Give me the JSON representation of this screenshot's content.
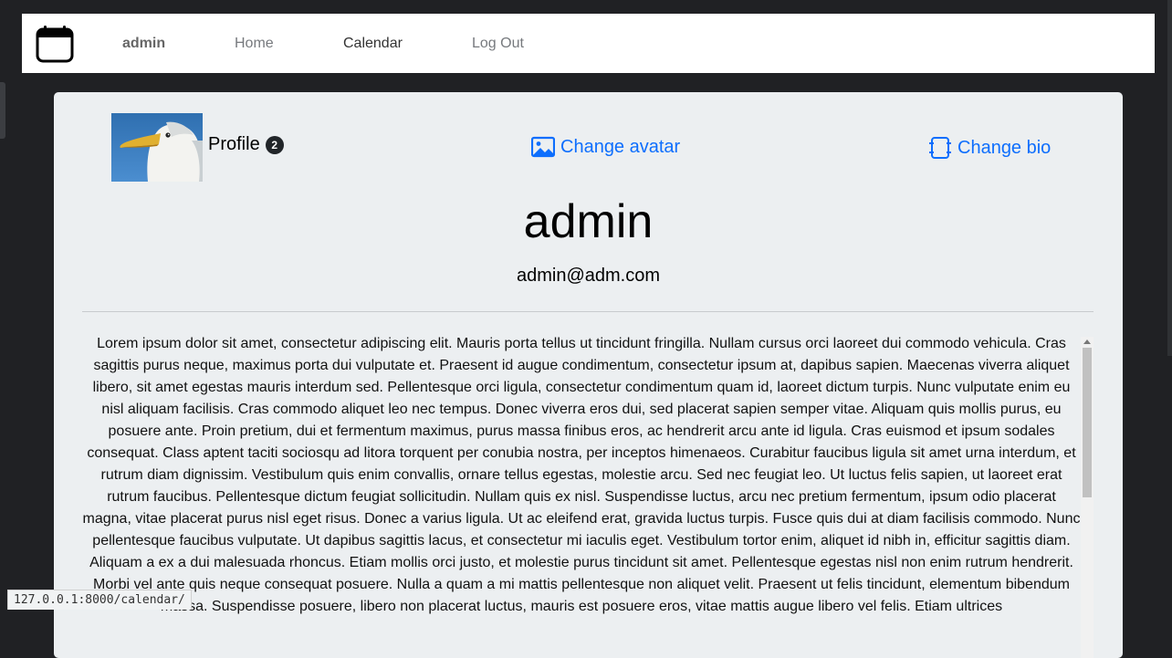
{
  "nav": {
    "brand_icon": "calendar-icon",
    "user": "admin",
    "home": "Home",
    "calendar": "Calendar",
    "logout": "Log Out"
  },
  "profile": {
    "label": "Profile",
    "badge": "2",
    "change_avatar": "Change avatar",
    "change_bio": "Change bio",
    "username": "admin",
    "email": "admin@adm.com",
    "bio": "Lorem ipsum dolor sit amet, consectetur adipiscing elit. Mauris porta tellus ut tincidunt fringilla. Nullam cursus orci laoreet dui commodo vehicula. Cras sagittis purus neque, maximus porta dui vulputate et. Praesent id augue condimentum, consectetur ipsum at, dapibus sapien. Maecenas viverra aliquet libero, sit amet egestas mauris interdum sed. Pellentesque orci ligula, consectetur condimentum quam id, laoreet dictum turpis. Nunc vulputate enim eu nisl aliquam facilisis. Cras commodo aliquet leo nec tempus. Donec viverra eros dui, sed placerat sapien semper vitae. Aliquam quis mollis purus, eu posuere ante. Proin pretium, dui et fermentum maximus, purus massa finibus eros, ac hendrerit arcu ante id ligula. Cras euismod et ipsum sodales consequat. Class aptent taciti sociosqu ad litora torquent per conubia nostra, per inceptos himenaeos. Curabitur faucibus ligula sit amet urna interdum, et rutrum diam dignissim. Vestibulum quis enim convallis, ornare tellus egestas, molestie arcu. Sed nec feugiat leo. Ut luctus felis sapien, ut laoreet erat rutrum faucibus. Pellentesque dictum feugiat sollicitudin. Nullam quis ex nisl. Suspendisse luctus, arcu nec pretium fermentum, ipsum odio placerat magna, vitae placerat purus nisl eget risus. Donec a varius ligula. Ut ac eleifend erat, gravida luctus turpis. Fusce quis dui at diam facilisis commodo. Nunc pellentesque faucibus vulputate. Ut dapibus sagittis lacus, et consectetur mi iaculis eget. Vestibulum tortor enim, aliquet id nibh in, efficitur sagittis diam. Aliquam a ex a dui malesuada rhoncus. Etiam mollis orci justo, et molestie purus tincidunt sit amet. Pellentesque egestas nisl non enim rutrum hendrerit. Morbi vel ante quis neque consequat posuere. Nulla a quam a mi mattis pellentesque non aliquet velit. Praesent ut felis tincidunt, elementum bibendum massa. Suspendisse posuere, libero non placerat luctus, mauris est posuere eros, vitae mattis augue libero vel felis. Etiam ultrices"
  },
  "status_bar": {
    "url": "127.0.0.1:8000/calendar/"
  },
  "colors": {
    "link": "#0d6efd",
    "card_bg": "#eceff1",
    "page_bg": "#202124"
  }
}
